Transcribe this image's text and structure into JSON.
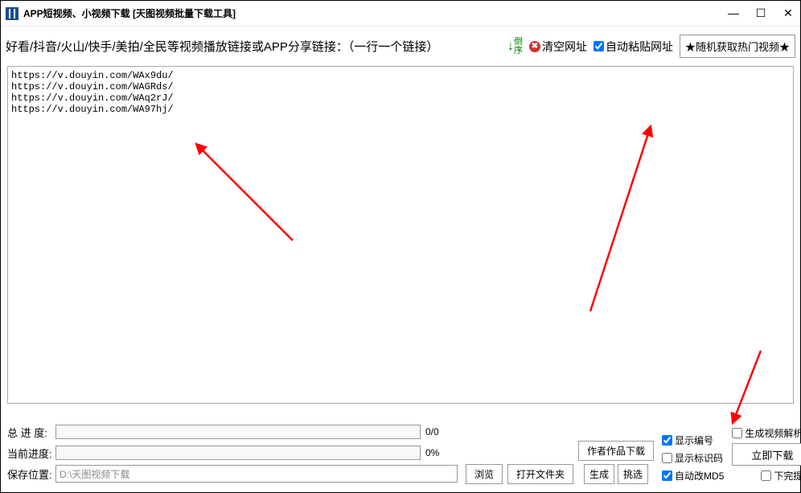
{
  "title": "APP短视频、小视频下载 [天图视频批量下载工具]",
  "toolbar": {
    "prompt": "好看/抖音/火山/快手/美拍/全民等视频播放链接或APP分享链接：（一行一个链接）",
    "sort_char1": "倒",
    "sort_char2": "序",
    "clear_label": "清空网址",
    "auto_paste_label": "自动粘贴网址",
    "auto_paste_checked": true,
    "hot_label": "★随机获取热门视频★"
  },
  "urls": "https://v.douyin.com/WAx9du/\nhttps://v.douyin.com/WAGRds/\nhttps://v.douyin.com/WAq2rJ/\nhttps://v.douyin.com/WA97hj/",
  "progress": {
    "total_label": "总 进 度:",
    "total_val": "0/0",
    "current_label": "当前进度:",
    "current_val": "0%"
  },
  "save": {
    "label": "保存位置:",
    "path": "D:\\天图视频下载"
  },
  "buttons": {
    "author": "作者作品下载",
    "browse": "浏览",
    "open_folder": "打开文件夹",
    "generate": "生成",
    "select": "挑选",
    "download_now": "立即下载"
  },
  "checks": {
    "show_index": "显示编号",
    "show_index_checked": true,
    "show_idcode": "显示标识码",
    "show_idcode_checked": false,
    "auto_md5": "自动改MD5",
    "auto_md5_checked": true,
    "gen_table": "生成视频解析表格",
    "gen_table_checked": false,
    "done_sound": "下完提示音",
    "done_sound_checked": false
  }
}
